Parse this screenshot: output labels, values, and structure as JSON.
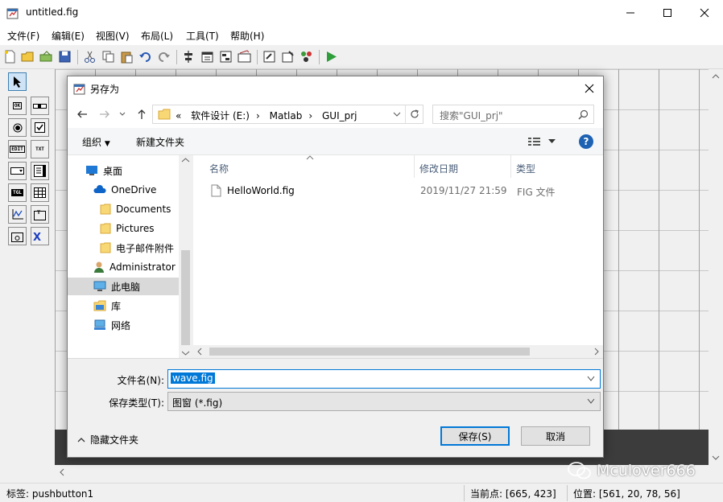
{
  "window": {
    "title": "untitled.fig",
    "menu": [
      "文件(F)",
      "编辑(E)",
      "视图(V)",
      "布局(L)",
      "工具(T)",
      "帮助(H)"
    ]
  },
  "dialog": {
    "title": "另存为",
    "address": {
      "prefix": "«",
      "segments": [
        "软件设计 (E:)",
        "Matlab",
        "GUI_prj"
      ]
    },
    "search_placeholder": "搜索\"GUI_prj\"",
    "organize_label": "组织",
    "new_folder_label": "新建文件夹",
    "nav_items": [
      {
        "label": "桌面",
        "icon": "desktop-icon"
      },
      {
        "label": "OneDrive",
        "icon": "cloud-icon"
      },
      {
        "label": "Documents",
        "icon": "folder-icon"
      },
      {
        "label": "Pictures",
        "icon": "folder-icon"
      },
      {
        "label": "电子邮件附件",
        "icon": "folder-icon"
      },
      {
        "label": "Administrator",
        "icon": "user-icon"
      },
      {
        "label": "此电脑",
        "icon": "computer-icon"
      },
      {
        "label": "库",
        "icon": "library-icon"
      },
      {
        "label": "网络",
        "icon": "network-icon"
      }
    ],
    "columns": [
      "名称",
      "修改日期",
      "类型"
    ],
    "files": [
      {
        "name": "HelloWorld.fig",
        "date": "2019/11/27 21:59",
        "type": "FIG 文件"
      }
    ],
    "filename_label": "文件名(N):",
    "filename_value": "wave.fig",
    "filetype_label": "保存类型(T):",
    "filetype_value": "图窗 (*.fig)",
    "hide_folders_label": "隐藏文件夹",
    "save_label": "保存(S)",
    "cancel_label": "取消"
  },
  "status": {
    "tag": "标签: pushbutton1",
    "current_point": "当前点:  [665, 423]",
    "position": "位置: [561, 20, 78, 56]"
  },
  "watermark": "Mculover666"
}
